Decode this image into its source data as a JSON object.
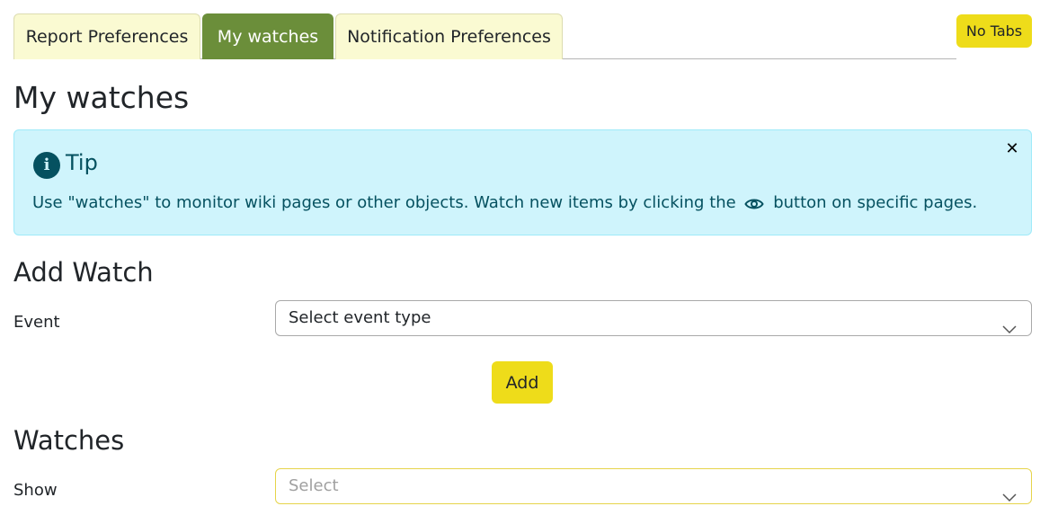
{
  "tabs": [
    {
      "label": "Report Preferences",
      "active": false
    },
    {
      "label": "My watches",
      "active": true
    },
    {
      "label": "Notification Preferences",
      "active": false
    }
  ],
  "no_tabs_label": "No Tabs",
  "page_title": "My watches",
  "tip": {
    "title": "Tip",
    "text_before": "Use \"watches\" to monitor wiki pages or other objects. Watch new items by clicking the",
    "text_after": "button on specific pages.",
    "icon": "info-icon",
    "inline_icon": "eye-icon",
    "close_icon": "close-icon"
  },
  "add_watch": {
    "title": "Add Watch",
    "event_label": "Event",
    "event_select_value": "Select event type",
    "add_button_label": "Add"
  },
  "watches": {
    "title": "Watches",
    "show_label": "Show",
    "show_select_placeholder": "Select"
  },
  "colors": {
    "active_tab": "#6b8e3a",
    "inactive_tab": "#fafad2",
    "button_yellow": "#eedc1a",
    "tip_background": "#cff4fc",
    "tip_text": "#055160"
  }
}
